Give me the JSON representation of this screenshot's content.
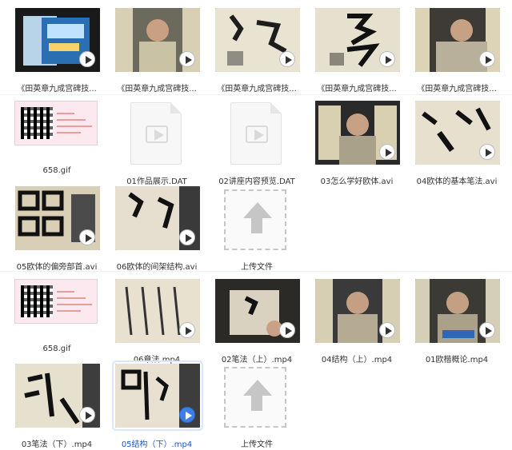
{
  "files": {
    "row1": [
      {
        "name": "《田英章九成宫碑技..."
      },
      {
        "name": "《田英章九成宫碑技..."
      },
      {
        "name": "《田英章九成宫碑技..."
      },
      {
        "name": "《田英章九成宫碑技..."
      },
      {
        "name": "《田英章九成宫碑技..."
      }
    ],
    "row2": [
      {
        "name": "658.gif"
      },
      {
        "name": "01作品展示.DAT"
      },
      {
        "name": "02讲座内容预览.DAT"
      },
      {
        "name": "03怎么学好欧体.avi"
      },
      {
        "name": "04欧体的基本笔法.avi"
      }
    ],
    "row3": [
      {
        "name": "05欧体的偏旁部首.avi"
      },
      {
        "name": "06欧体的间架结构.avi"
      },
      {
        "name": "上传文件"
      }
    ],
    "row4": [
      {
        "name": "658.gif"
      },
      {
        "name": "06章法.mp4"
      },
      {
        "name": "02笔法（上）.mp4"
      },
      {
        "name": "04结构（上）.mp4"
      },
      {
        "name": "01欧楷概论.mp4"
      }
    ],
    "row5": [
      {
        "name": "03笔法（下）.mp4"
      },
      {
        "name": "05结构（下）.mp4"
      },
      {
        "name": "上传文件"
      }
    ]
  }
}
